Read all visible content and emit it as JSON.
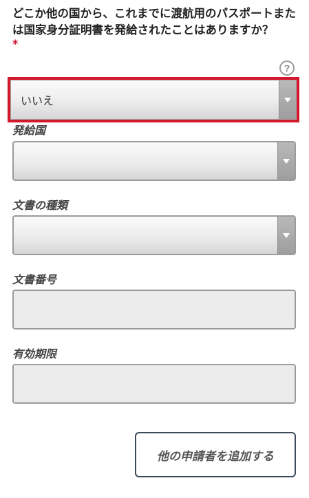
{
  "question": {
    "text": "どこか他の国から、これまでに渡航用のパスポートまたは国家身分証明書を発給されたことはありますか？",
    "required_mark": "*"
  },
  "help": {
    "symbol": "?"
  },
  "issued_before": {
    "value": "いいえ"
  },
  "issuing_country": {
    "label": "発給国",
    "value": ""
  },
  "document_type": {
    "label": "文書の種類",
    "value": ""
  },
  "document_number": {
    "label": "文書番号",
    "value": ""
  },
  "expiry_date": {
    "label": "有効期限",
    "value": ""
  },
  "actions": {
    "add_applicant_label": "他の申請者を追加する"
  },
  "colors": {
    "error_outline": "#d3182b",
    "required": "#c8102e",
    "button_border": "#3d4a5c"
  }
}
